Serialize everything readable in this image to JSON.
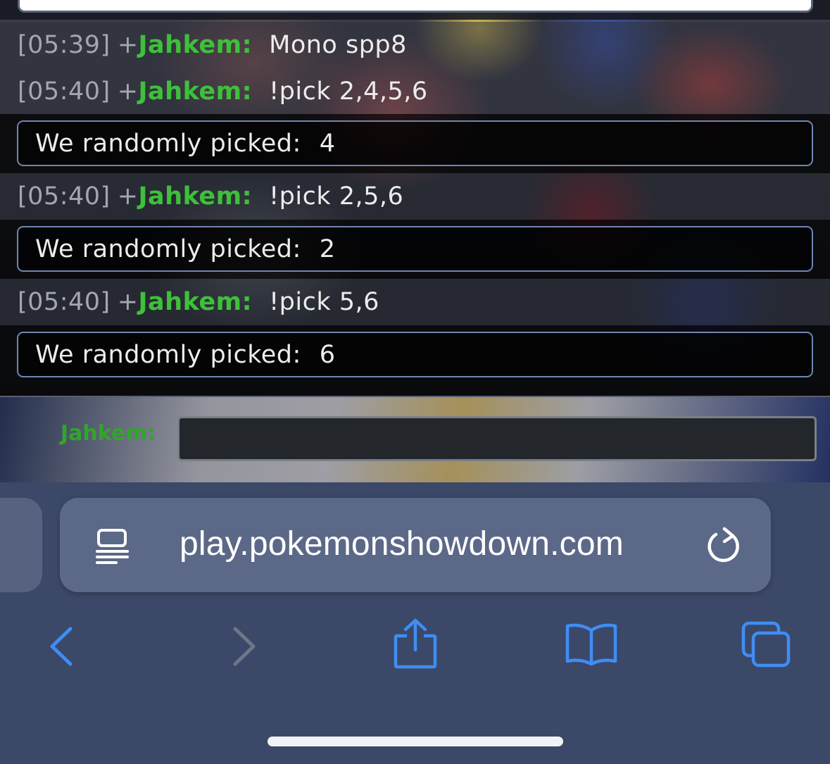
{
  "chat": {
    "messages": [
      {
        "timestamp": "[05:39]",
        "rank": "+",
        "user": "Jahkem:",
        "text": "Mono spp8"
      },
      {
        "timestamp": "[05:40]",
        "rank": "+",
        "user": "Jahkem:",
        "text": "!pick 2,4,5,6"
      },
      {
        "timestamp": "[05:40]",
        "rank": "+",
        "user": "Jahkem:",
        "text": "!pick 2,5,6"
      },
      {
        "timestamp": "[05:40]",
        "rank": "+",
        "user": "Jahkem:",
        "text": "!pick 5,6"
      }
    ],
    "picks": [
      {
        "label": "We randomly picked:",
        "value": "4"
      },
      {
        "label": "We randomly picked:",
        "value": "2"
      },
      {
        "label": "We randomly picked:",
        "value": "6"
      }
    ]
  },
  "compose": {
    "user_label": "Jahkem:",
    "input_value": ""
  },
  "browser": {
    "url": "play.pokemonshowdown.com",
    "icons": [
      "reader-mode-icon",
      "reload-icon",
      "back-icon",
      "forward-icon",
      "share-icon",
      "bookmarks-icon",
      "tabs-icon"
    ],
    "accent_color": "#3f8df5",
    "disabled_color": "#6e7789"
  },
  "colors": {
    "username": "#3ec03a",
    "timestamp": "#a3a6ae",
    "pick_border": "#6f86b0",
    "toolbar_bg": "#3b4868",
    "url_bar_bg": "#5c6887"
  }
}
